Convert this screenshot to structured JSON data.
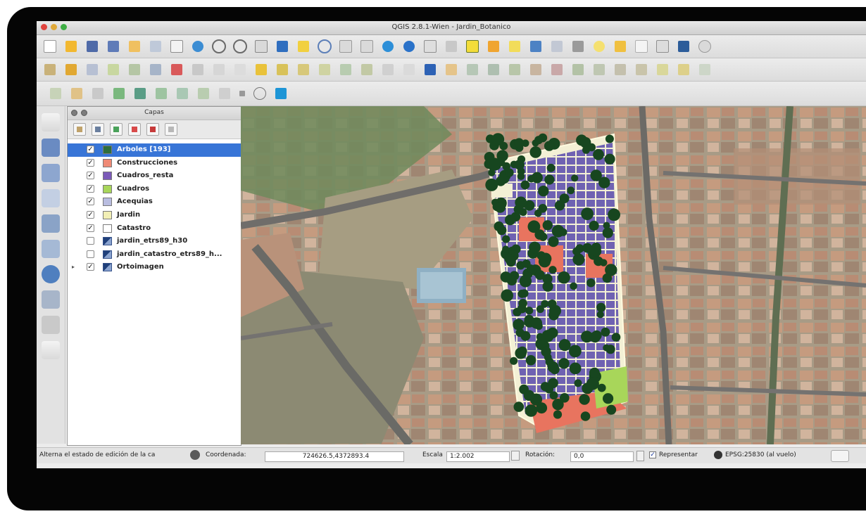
{
  "window": {
    "title": "QGIS 2.8.1-Wien - Jardin_Botanico"
  },
  "layers_panel": {
    "title": "Capas",
    "layers": [
      {
        "name": "Arboles [193]",
        "checked": true,
        "selected": true,
        "swatch": "#2f6e3b"
      },
      {
        "name": "Construcciones",
        "checked": true,
        "swatch": "#ef8a76"
      },
      {
        "name": "Cuadros_resta",
        "checked": true,
        "swatch": "#7b5ab8"
      },
      {
        "name": "Cuadros",
        "checked": true,
        "swatch": "#a8d65a"
      },
      {
        "name": "Acequias",
        "checked": true,
        "swatch": "#b9bde0"
      },
      {
        "name": "Jardin",
        "checked": true,
        "swatch": "#f2efb5"
      },
      {
        "name": "Catastro",
        "checked": true,
        "swatch": "#ffffff"
      },
      {
        "name": "jardin_etrs89_h30",
        "checked": false,
        "swatch": "raster"
      },
      {
        "name": "jardin_catastro_etrs89_h...",
        "checked": false,
        "swatch": "raster"
      },
      {
        "name": "Ortoimagen",
        "checked": true,
        "swatch": "raster",
        "expandable": true
      }
    ]
  },
  "statusbar": {
    "hint": "Alterna el estado de edición de la ca",
    "coord_label": "Coordenada:",
    "coord_value": "724626.5,4372893.4",
    "scale_label": "Escala",
    "scale_value": "1:2.002",
    "rotation_label": "Rotación:",
    "rotation_value": "0,0",
    "render_label": "Representar",
    "crs_label": "EPSG:25830 (al vuelo)"
  },
  "colors": {
    "selection": "#3875d7",
    "tree_canopy": "#17461f",
    "plots": "#6f62b2",
    "buildings": "#e8745f"
  }
}
